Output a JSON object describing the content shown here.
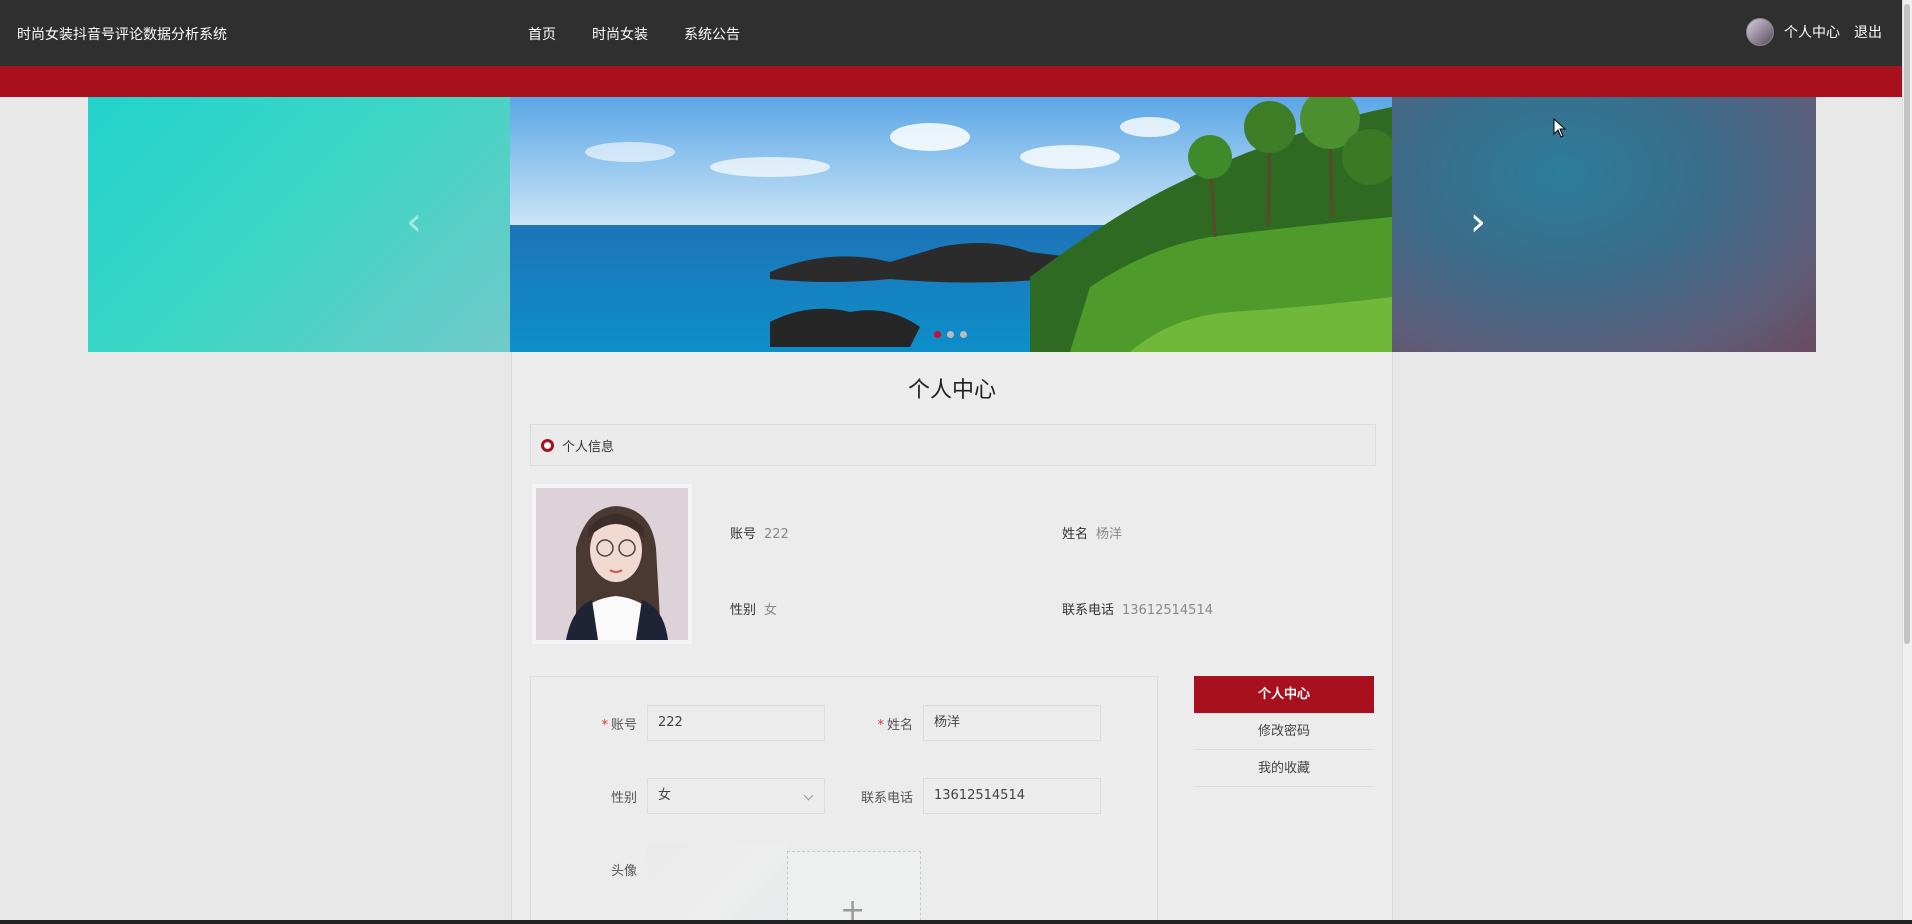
{
  "header": {
    "site_title": "时尚女装抖音号评论数据分析系统",
    "nav": [
      "首页",
      "时尚女装",
      "系统公告"
    ],
    "user_center": "个人中心",
    "logout": "退出"
  },
  "carousel": {
    "prev_glyph": "‹",
    "next_glyph": "›",
    "slide_count": 3,
    "active_index": 0
  },
  "page": {
    "title": "个人中心",
    "section_title": "个人信息"
  },
  "profile": {
    "account_label": "账号",
    "account_value": "222",
    "name_label": "姓名",
    "name_value": "杨洋",
    "gender_label": "性别",
    "gender_value": "女",
    "phone_label": "联系电话",
    "phone_value": "13612514514"
  },
  "form": {
    "account_label": "账号",
    "account_value": "222",
    "name_label": "姓名",
    "name_value": "杨洋",
    "gender_label": "性别",
    "gender_value": "女",
    "phone_label": "联系电话",
    "phone_value": "13612514514",
    "avatar_label": "头像",
    "upload_glyph": "+"
  },
  "side_menu": {
    "items": [
      "个人中心",
      "修改密码",
      "我的收藏"
    ]
  },
  "colors": {
    "brand_red": "#a8101e",
    "topbar": "#2f2f2f"
  }
}
